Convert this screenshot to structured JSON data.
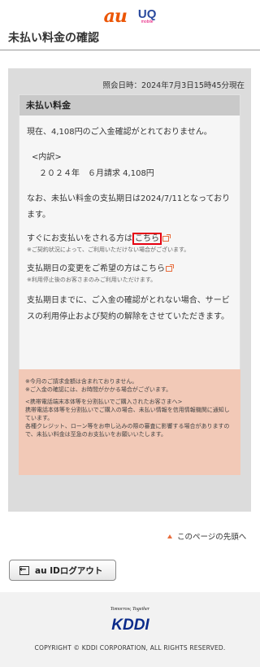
{
  "header": {
    "au_logo": "au",
    "uq_logo": "UQ",
    "uq_sub": "mobile"
  },
  "page": {
    "title": "未払い料金の確認"
  },
  "inquiry": {
    "date_text": "照会日時：2024年7月3日15時45分現在"
  },
  "panel": {
    "heading": "未払い料金",
    "status": "現在、4,108円のご入金確認がとれておりません。",
    "breakdown_label": "<内訳>",
    "breakdown_item": "２０２４年　６月請求 4,108円",
    "due_notice": "なお、未払い料金の支払期日は2024/7/11となっております。",
    "pay_prompt": "すぐにお支払いをされる方は",
    "pay_link": "こちら",
    "pay_note": "※ご契約状況によって、ご利用いただけない場合がございます。",
    "change_prompt": "支払期日の変更をご希望の方は",
    "change_link": "こちら",
    "change_note": "※利用停止後のお客さまのみご利用いただけます。",
    "warning": "支払期日までに、ご入金の確認がとれない場合、サービスの利用停止および契約の解除をさせていただきます。"
  },
  "notice": {
    "line1": "※今月のご請求金額は含まれておりません。",
    "line2": "※ご入金の確認には、お時間がかかる場合がございます。",
    "line3": "<携帯電話端末本体等を分割払いでご購入されたお客さまへ>",
    "line4": "携帯電話本体等を分割払いでご購入の場合、未払い情報を信用情報機関に通知しています。",
    "line5": "各種クレジット、ローン等をお申し込みの際の審査に影響する場合がありますので、未払い料金は至急のお支払いをお願いいたします。"
  },
  "nav": {
    "pagetop": "このページの先頭へ",
    "logout": "au IDログアウト"
  },
  "footer": {
    "tagline": "Tomorrow, Together",
    "logo": "KDDI",
    "copyright": "COPYRIGHT © KDDI CORPORATION, ALL RIGHTS RESERVED."
  }
}
